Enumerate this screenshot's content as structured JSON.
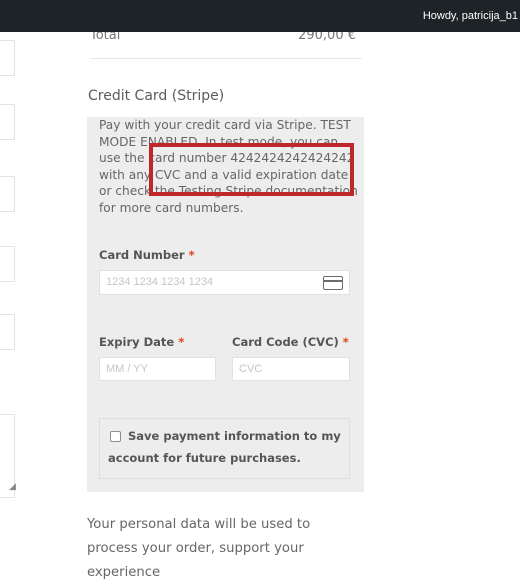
{
  "admin_bar": {
    "greeting": "Howdy, patricija_b1"
  },
  "order_total": {
    "label": "Total",
    "value": "290,00 €"
  },
  "payment_method": {
    "title": "Credit Card (Stripe)",
    "description": "Pay with your credit card via Stripe. TEST MODE ENABLED. In test mode, you can use the card number 4242424242424242 with any CVC and a valid expiration date or check the Testing Stripe documentation for more card numbers.",
    "card_number": {
      "label": "Card Number",
      "required": "*",
      "placeholder": "1234 1234 1234 1234",
      "icon": "credit-card-icon"
    },
    "expiry": {
      "label": "Expiry Date",
      "required": "*",
      "placeholder": "MM / YY"
    },
    "cvc": {
      "label": "Card Code (CVC)",
      "required": "*",
      "placeholder": "CVC"
    },
    "save_payment": {
      "label": "Save payment information to my account for future purchases.",
      "checked": false
    }
  },
  "privacy_text": "Your personal data will be used to process your order, support your experience",
  "colors": {
    "admin_bar": "#1d2327",
    "highlight": "#c0272d",
    "required": "#e2401c",
    "payment_box": "#ededed"
  }
}
